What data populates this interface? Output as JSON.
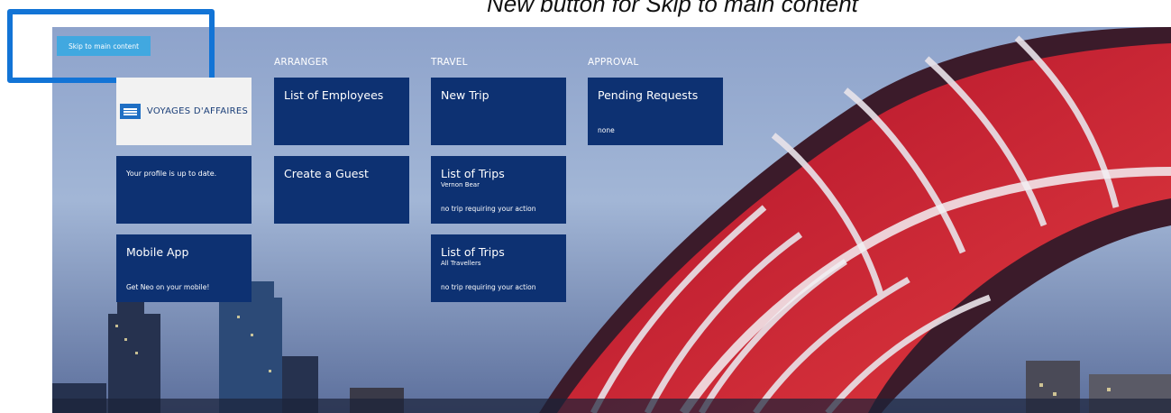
{
  "caption": "New button for Skip to main content",
  "skip_link": "Skip to main content",
  "columns": {
    "arranger": "ARRANGER",
    "travel": "TRAVEL",
    "approval": "APPROVAL"
  },
  "brand": {
    "name": "VOYAGES D'AFFAIRES"
  },
  "tiles": {
    "profile": {
      "text": "Your profile is up to date."
    },
    "mobile": {
      "title": "Mobile App",
      "footer": "Get Neo on your mobile!"
    },
    "employees": {
      "title": "List of Employees"
    },
    "guest": {
      "title": "Create a Guest"
    },
    "new_trip": {
      "title": "New Trip"
    },
    "trips_self": {
      "title": "List of Trips",
      "subtitle": "Vernon Bear",
      "footer": "no trip requiring your action"
    },
    "trips_all": {
      "title": "List of Trips",
      "subtitle": "All Travellers",
      "footer": "no trip requiring your action"
    },
    "pending": {
      "title": "Pending Requests",
      "footer": "none"
    }
  },
  "colors": {
    "tile": "#0d3172",
    "skip": "#41a8e0",
    "highlight": "#1274d6"
  }
}
